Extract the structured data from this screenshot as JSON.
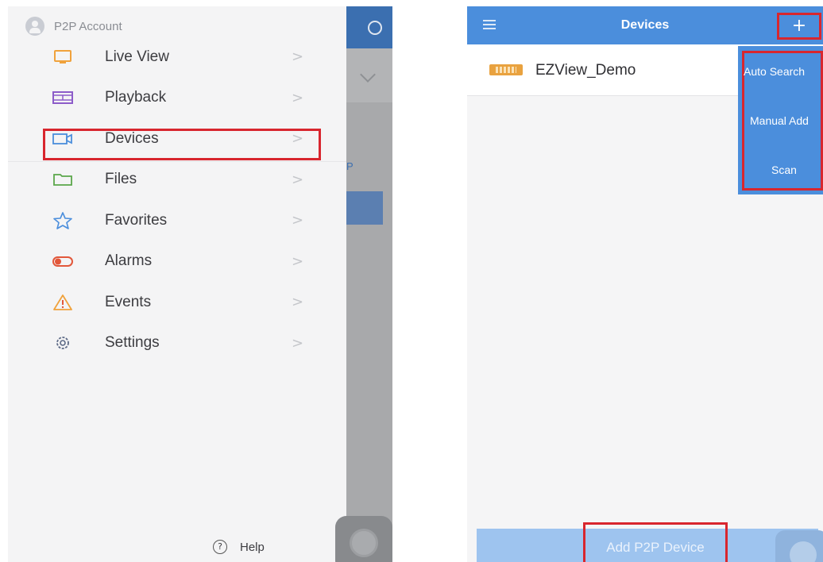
{
  "left": {
    "account_label": "P2P Account",
    "menu": [
      {
        "key": "live-view",
        "label": "Live View",
        "icon": "monitor-icon"
      },
      {
        "key": "playback",
        "label": "Playback",
        "icon": "film-icon"
      },
      {
        "key": "devices",
        "label": "Devices",
        "icon": "camera-icon"
      },
      {
        "key": "files",
        "label": "Files",
        "icon": "folder-icon"
      },
      {
        "key": "favorites",
        "label": "Favorites",
        "icon": "star-icon"
      },
      {
        "key": "alarms",
        "label": "Alarms",
        "icon": "toggle-icon"
      },
      {
        "key": "events",
        "label": "Events",
        "icon": "warning-icon"
      },
      {
        "key": "settings",
        "label": "Settings",
        "icon": "gear-icon"
      }
    ],
    "chevron": ">",
    "help_label": "Help",
    "peek_text": "P"
  },
  "right": {
    "title": "Devices",
    "plus_label": "+",
    "device_name": "EZView_Demo",
    "dropdown": [
      "Auto Search",
      "Manual Add",
      "Scan"
    ],
    "bottom_button": "Add P2P Device"
  },
  "colors": {
    "accent_blue": "#4b8edc",
    "highlight_red": "#d8262e"
  }
}
